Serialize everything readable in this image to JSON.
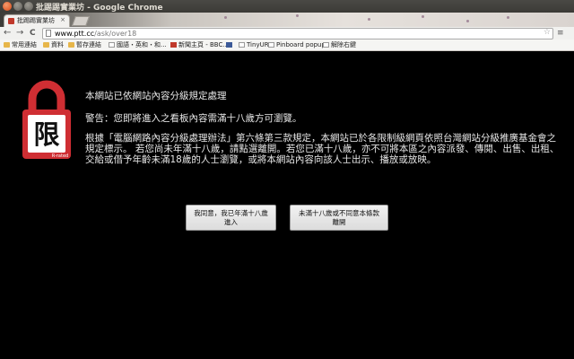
{
  "window": {
    "title": "批踢踢實業坊 - Google Chrome",
    "controls": [
      "close",
      "minimize",
      "maximize"
    ]
  },
  "tabs": [
    {
      "label": "批踢踢實業坊",
      "close": "×",
      "active": true
    }
  ],
  "toolbar": {
    "back": "←",
    "forward": "→",
    "reload": "C",
    "url_host": "www.ptt.cc",
    "url_path": "/ask/over18",
    "star": "☆",
    "menu": "≡"
  },
  "bookmarks": [
    {
      "label": "常用連結",
      "icon": "folder"
    },
    {
      "label": "資料",
      "icon": "folder"
    },
    {
      "label": "暫存連結",
      "icon": "folder"
    },
    {
      "label": "國語・英和・和...",
      "icon": "page"
    },
    {
      "label": "新聞主頁 - BBC...",
      "icon": "page-red"
    },
    {
      "label": "",
      "icon": "facebook"
    },
    {
      "label": "TinyURL!",
      "icon": "page"
    },
    {
      "label": "Pinboard popup",
      "icon": "page"
    },
    {
      "label": "解除右鍵",
      "icon": "page"
    }
  ],
  "logo": {
    "char": "限",
    "caption": "R-rated",
    "color": "#cf2e33"
  },
  "content": {
    "line1": "本網站已依網站內容分級規定處理",
    "line2": "警告：您即將進入之看板內容需滿十八歲方可瀏覽。",
    "line3": "根據「電腦網路內容分級處理辦法」第六條第三款規定，本網站已於各限制級網頁依照台灣網站分級推廣基金會之規定標示。 若您尚未年滿十八歲，請點選離開。若您已滿十八歲，亦不可將本區之內容派發、傳閱、出售、出租、交給或借予年齡未滿18歲的人士瀏覽，或將本網站內容向該人士出示、播放或放映。"
  },
  "buttons": {
    "yes_line1": "我同意，我已年滿十八歲",
    "yes_line2": "進入",
    "no_line1": "未滿十八歲或不同意本條款",
    "no_line2": "離開"
  }
}
